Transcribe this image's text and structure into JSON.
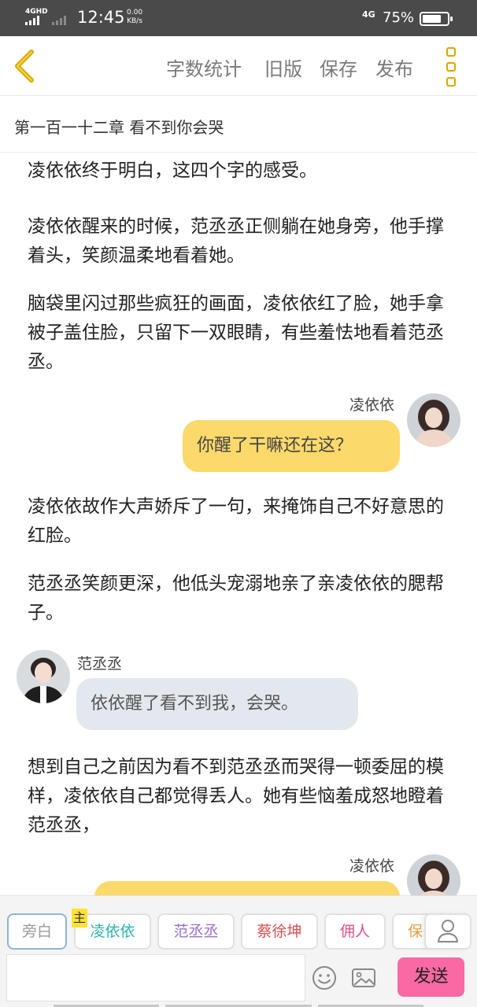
{
  "status_bar": {
    "network_label": "4GHD",
    "time": "12:45",
    "speed_value": "0.00",
    "speed_unit": "KB/s",
    "network_right": "4G",
    "battery_percent": "75%",
    "battery_level": 0.75
  },
  "toolbar": {
    "back_icon": "chevron-left-icon",
    "actions": [
      "字数统计",
      "旧版",
      "保存",
      "发布"
    ],
    "more_icon": "more-vertical-icon",
    "accent_color": "#d9a800"
  },
  "chapter": {
    "title": "第一百一十二章  看不到你会哭"
  },
  "content": {
    "para1": "凌依依终于明白，这四个字的感受。",
    "para2": "凌依依醒来的时候，范丞丞正侧躺在她身旁，他手撑着头，笑颜温柔地看着她。",
    "para3": "脑袋里闪过那些疯狂的画面，凌依依红了脸，她手拿被子盖住脸，只留下一双眼睛，有些羞怯地看着范丞丞。",
    "msg1": {
      "speaker": "凌依依",
      "text": "你醒了干嘛还在这？"
    },
    "para4": "凌依依故作大声娇斥了一句，来掩饰自己不好意思的红脸。",
    "para5": "范丞丞笑颜更深，他低头宠溺地亲了亲凌依依的腮帮子。",
    "msg2": {
      "speaker": "范丞丞",
      "text": "依依醒了看不到我，会哭。"
    },
    "para6": "想到自己之前因为看不到范丞丞而哭得一顿委屈的模样，凌依依自己都觉得丢人。她有些恼羞成怒地瞪着范丞丞，",
    "msg3": {
      "speaker": "凌依依",
      "text": ""
    }
  },
  "input_area": {
    "main_tag": "主",
    "chips": [
      {
        "label": "旁白",
        "color": "#999999"
      },
      {
        "label": "凌依依",
        "color": "#2bb3b3"
      },
      {
        "label": "范丞丞",
        "color": "#9a6fd0"
      },
      {
        "label": "蔡徐坤",
        "color": "#d85050"
      },
      {
        "label": "佣人",
        "color": "#e0508a"
      },
      {
        "label": "保",
        "color": "#e7a04a"
      }
    ],
    "input_placeholder": "",
    "send_label": "发送",
    "send_color": "#f969a3",
    "icons": [
      "person-icon",
      "emoji-icon",
      "image-icon"
    ]
  }
}
